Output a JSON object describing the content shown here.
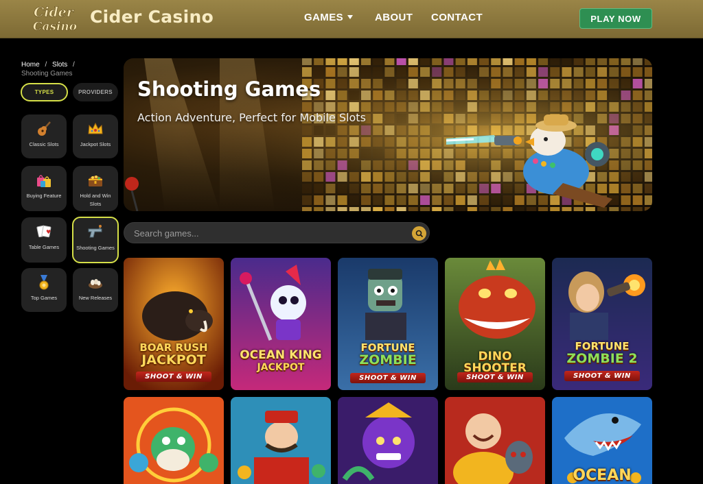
{
  "header": {
    "logo_line1": "Cider",
    "logo_line2": "Casino",
    "site_name": "Cider Casino",
    "nav": {
      "games": "GAMES",
      "about": "ABOUT",
      "contact": "CONTACT"
    },
    "cta": "PLAY NOW"
  },
  "breadcrumb": {
    "home": "Home",
    "sep": "/",
    "slots": "Slots",
    "current": "Shooting Games"
  },
  "filters": {
    "types": "TYPES",
    "providers": "PROVIDERS"
  },
  "categories": [
    {
      "label": "Classic Slots",
      "icon": "guitar-icon"
    },
    {
      "label": "Jackpot Slots",
      "icon": "crown-icon"
    },
    {
      "label": "Buying Feature",
      "icon": "shopping-bags-icon"
    },
    {
      "label": "Hold and Win Slots",
      "icon": "treasure-chest-icon"
    },
    {
      "label": "Table Games",
      "icon": "playing-cards-icon"
    },
    {
      "label": "Shooting Games",
      "icon": "pistol-icon",
      "active": true
    },
    {
      "label": "Top Games",
      "icon": "medal-icon"
    },
    {
      "label": "New Releases",
      "icon": "nest-eggs-icon"
    }
  ],
  "banner": {
    "title": "Shooting Games",
    "subtitle": "Action Adventure, Perfect for Mobile Slots"
  },
  "search": {
    "placeholder": "Search games...",
    "icon": "search-icon"
  },
  "games": [
    {
      "title_line1": "BOAR RUSH",
      "title_line2": "JACKPOT",
      "sub": "SHOOT & WIN"
    },
    {
      "title_line1": "OCEAN KING",
      "title_line2": "JACKPOT",
      "sub": ""
    },
    {
      "title_line1": "FORTUNE",
      "title_line2": "ZOMBIE",
      "sub": "SHOOT & WIN"
    },
    {
      "title_line1": "DINO SHOOTER",
      "title_line2": "",
      "sub": "SHOOT & WIN"
    },
    {
      "title_line1": "FORTUNE",
      "title_line2": "ZOMBIE 2",
      "sub": "SHOOT & WIN"
    },
    {
      "title_line1": "",
      "title_line2": "",
      "sub": ""
    },
    {
      "title_line1": "",
      "title_line2": "",
      "sub": ""
    },
    {
      "title_line1": "",
      "title_line2": "",
      "sub": ""
    },
    {
      "title_line1": "",
      "title_line2": "",
      "sub": ""
    },
    {
      "title_line1": "OCEAN",
      "title_line2": "",
      "sub": ""
    }
  ],
  "colors": {
    "header_gold": "#8c7740",
    "accent_lime": "#d6e048",
    "cta_green": "#2e8f52",
    "search_gold": "#d4a537"
  }
}
